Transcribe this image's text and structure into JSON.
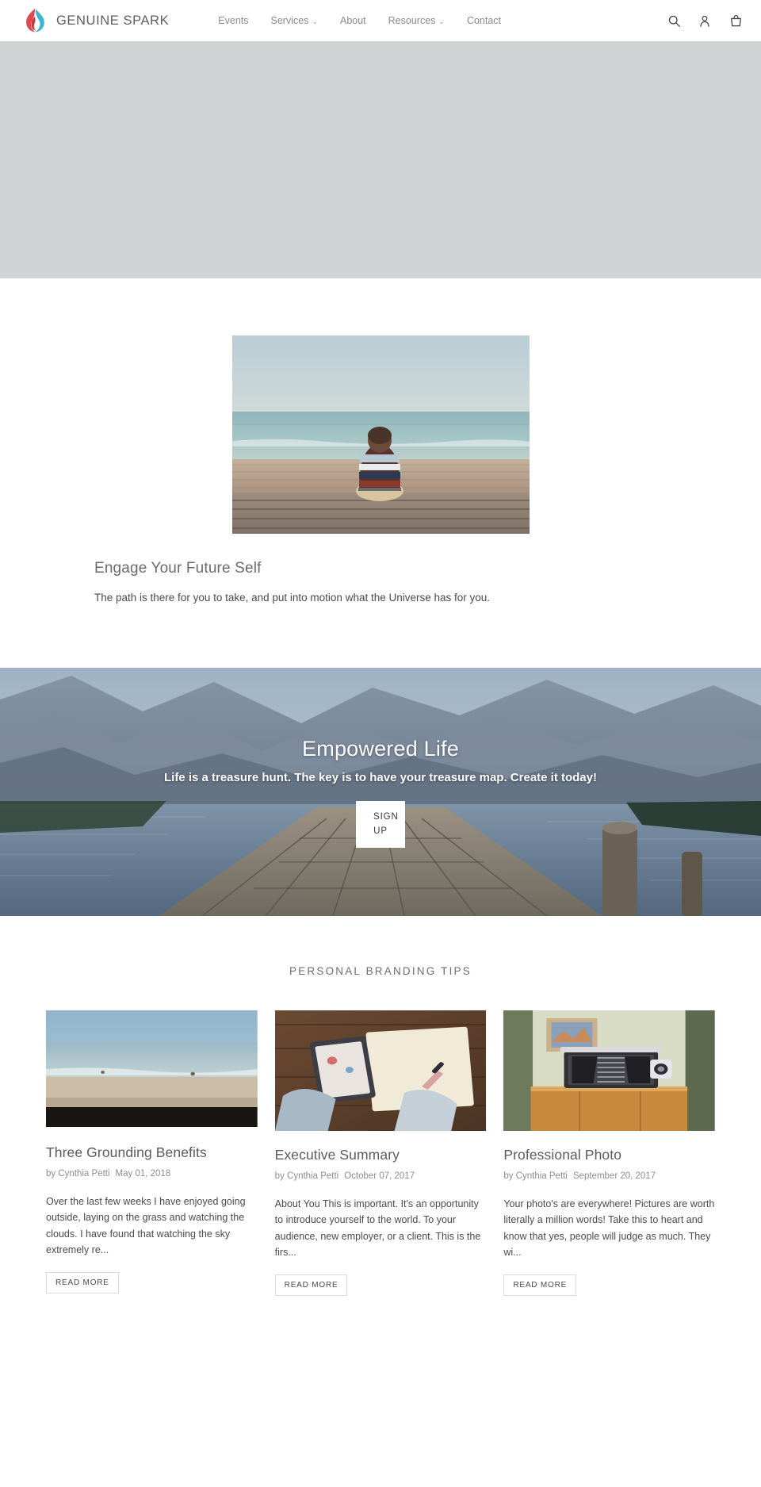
{
  "header": {
    "brand": {
      "name": "GENUINE SPARK",
      "logo_icon": "flame-logo-icon",
      "color_red": "#e0484f",
      "color_teal": "#3bb6cf"
    },
    "nav": [
      {
        "label": "Events",
        "has_dropdown": false
      },
      {
        "label": "Services",
        "has_dropdown": true,
        "caret": "⌄"
      },
      {
        "label": "About",
        "has_dropdown": false
      },
      {
        "label": "Resources",
        "has_dropdown": true,
        "caret": "⌄"
      },
      {
        "label": "Contact",
        "has_dropdown": false
      }
    ],
    "actions": [
      {
        "icon": "search-icon"
      },
      {
        "icon": "account-icon"
      },
      {
        "icon": "cart-icon"
      }
    ]
  },
  "hero_placeholder": {
    "background_color": "#d2d3d5"
  },
  "feature": {
    "image_alt": "man-sitting-on-dock-facing-ocean",
    "title": "Engage Your Future Self",
    "text": "The path is there for you to take, and put into motion what the Universe has for you."
  },
  "banner": {
    "image_alt": "wooden-pier-over-mountain-lake",
    "title": "Empowered Life",
    "subtitle": "Life is a treasure hunt. The key is to have your treasure map. Create it today!",
    "button_label": "SIGN UP"
  },
  "blog": {
    "heading": "PERSONAL BRANDING TIPS",
    "read_more_label": "READ MORE",
    "author_prefix": "by",
    "posts": [
      {
        "image_alt": "beach-shoreline-with-waves",
        "title": "Three Grounding Benefits",
        "author": "by Cynthia Petti",
        "date": "May 01, 2018",
        "excerpt": "Over the last few weeks I have enjoyed going outside, laying on the grass and watching the clouds. I have found that watching the sky extremely re...",
        "read_more": "READ MORE"
      },
      {
        "image_alt": "person-writing-in-notebook-with-phone",
        "title": "Executive Summary",
        "author": "by Cynthia Petti",
        "date": "October 07, 2017",
        "excerpt": "About You This is important. It's an opportunity to introduce yourself to the world.  To your audience, new employer, or a client. This is the firs...",
        "read_more": "READ MORE"
      },
      {
        "image_alt": "vintage-bellows-camera-on-cabinet",
        "title": "Professional Photo",
        "author": "by Cynthia Petti",
        "date": "September 20, 2017",
        "excerpt": "Your photo's are everywhere! Pictures are worth literally a million words! Take this to heart and know that yes, people will judge as much. They wi...",
        "read_more": "READ MORE"
      }
    ]
  }
}
